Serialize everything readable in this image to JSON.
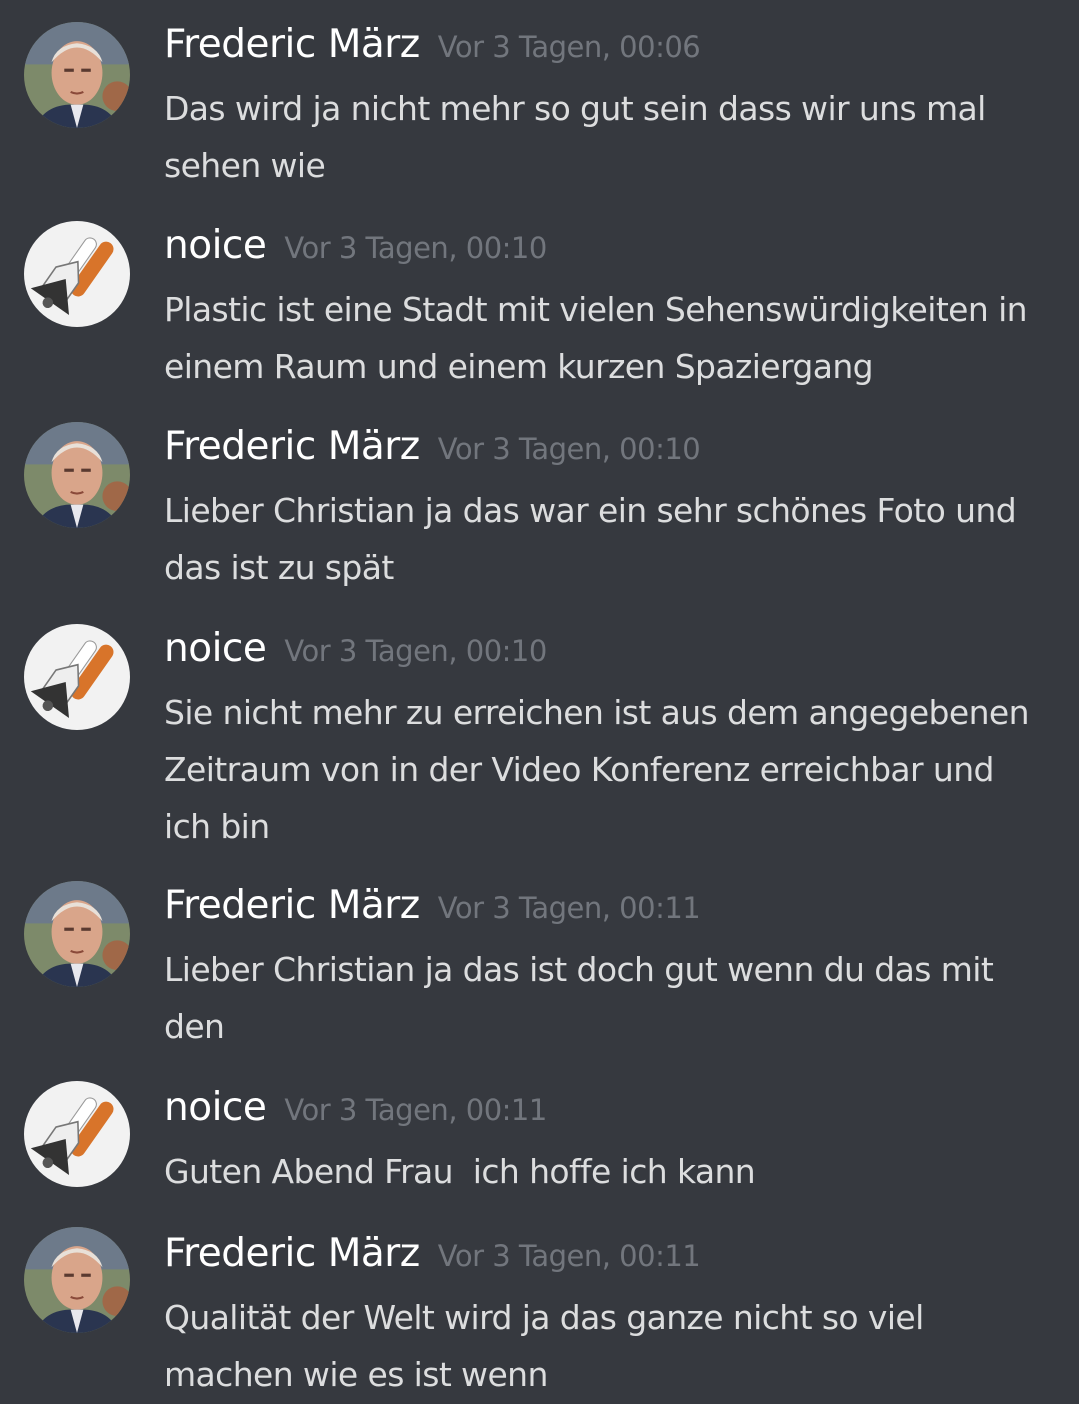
{
  "messages": [
    {
      "author": "Frederic März",
      "timestamp": "Vor 3 Tagen, 00:06",
      "text": "Das wird ja nicht mehr so gut sein dass wir uns mal sehen wie",
      "avatar": "man-portrait-avatar"
    },
    {
      "author": "noice",
      "timestamp": "Vor 3 Tagen, 00:10",
      "text": "Plastic ist eine Stadt mit vielen Sehenswürdigkeiten in einem Raum und einem kurzen Spaziergang",
      "avatar": "space-shuttle-avatar"
    },
    {
      "author": "Frederic März",
      "timestamp": "Vor 3 Tagen, 00:10",
      "text": "Lieber Christian ja das war ein sehr schönes Foto und das ist zu spät",
      "avatar": "man-portrait-avatar"
    },
    {
      "author": "noice",
      "timestamp": "Vor 3 Tagen, 00:10",
      "text": "Sie nicht mehr zu erreichen ist aus dem angegebenen Zeitraum von in der Video Konferenz erreichbar und ich bin",
      "avatar": "space-shuttle-avatar"
    },
    {
      "author": "Frederic März",
      "timestamp": "Vor 3 Tagen, 00:11",
      "text": "Lieber Christian ja das ist doch gut wenn du das mit den",
      "avatar": "man-portrait-avatar"
    },
    {
      "author": "noice",
      "timestamp": "Vor 3 Tagen, 00:11",
      "text": "Guten Abend Frau  ich hoffe ich kann",
      "avatar": "space-shuttle-avatar"
    },
    {
      "author": "Frederic März",
      "timestamp": "Vor 3 Tagen, 00:11",
      "text": "Qualität der Welt wird ja das ganze nicht so viel machen wie es ist wenn",
      "avatar": "man-portrait-avatar"
    }
  ],
  "colors": {
    "background": "#36393f",
    "username": "#ffffff",
    "timestamp": "#72767d",
    "message_text": "#dcddde"
  }
}
